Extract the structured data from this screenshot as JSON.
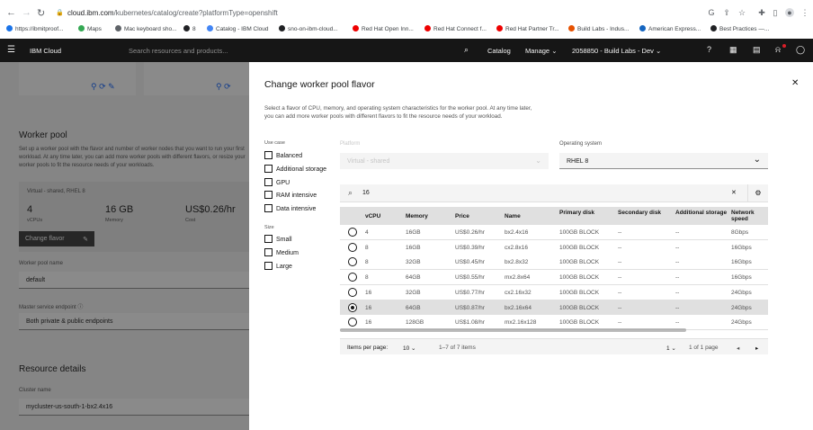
{
  "browser": {
    "url_host": "cloud.ibm.com",
    "url_path": "/kubernetes/catalog/create?platformType=openshift",
    "bookmarks": [
      {
        "label": "https://ibmitproof...",
        "color": "#1a73e8"
      },
      {
        "label": "Maps",
        "color": "#34a853"
      },
      {
        "label": "Mac keyboard sho...",
        "color": "#5f6368"
      },
      {
        "label": "8",
        "color": "#202124"
      },
      {
        "label": "Catalog - IBM Cloud",
        "color": "#4285f4"
      },
      {
        "label": "sno-on-ibm-cloud...",
        "color": "#202124"
      },
      {
        "label": "Red Hat Open Inn...",
        "color": "#ee0000"
      },
      {
        "label": "Red Hat Connect f...",
        "color": "#ee0000"
      },
      {
        "label": "Red Hat Partner Tr...",
        "color": "#ee0000"
      },
      {
        "label": "Build Labs - Indus...",
        "color": "#e65100"
      },
      {
        "label": "American Express...",
        "color": "#1565c0"
      },
      {
        "label": "Best Practices —...",
        "color": "#202124"
      }
    ]
  },
  "header": {
    "brand": "IBM Cloud",
    "search_placeholder": "Search resources and products...",
    "catalog": "Catalog",
    "manage": "Manage",
    "account": "2058850 - Build Labs - Dev"
  },
  "background": {
    "worker_pool_title": "Worker pool",
    "worker_pool_desc": "Set up a worker pool with the flavor and number of worker nodes that you want to run your first workload. At any time later, you can add more worker pools with different flavors, or resize your worker pools to fit the resource needs of your workloads.",
    "flavor_summary": "Virtual - shared, RHEL 8",
    "vcpu_value": "4",
    "vcpu_label": "vCPUs",
    "memory_value": "16 GB",
    "memory_label": "Memory",
    "cost_value": "US$0.26/hr",
    "cost_label": "Cost",
    "change_flavor": "Change flavor",
    "pool_name_label": "Worker pool name",
    "pool_name_value": "default",
    "endpoint_label": "Master service endpoint",
    "endpoint_value": "Both private & public endpoints",
    "resource_title": "Resource details",
    "cluster_name_label": "Cluster name",
    "cluster_name_value": "mycluster-us-south-1-bx2.4x16"
  },
  "modal": {
    "title": "Change worker pool flavor",
    "description": "Select a flavor of CPU, memory, and operating system characteristics for the worker pool. At any time later, you can add more worker pools with different flavors to fit the resource needs of your workload.",
    "use_case_label": "Use case",
    "use_cases": [
      "Balanced",
      "Additional storage",
      "GPU",
      "RAM intensive",
      "Data intensive"
    ],
    "size_label": "Size",
    "sizes": [
      "Small",
      "Medium",
      "Large"
    ],
    "platform_label": "Platform",
    "platform_value": "Virtual - shared",
    "os_label": "Operating system",
    "os_value": "RHEL 8",
    "search_value": "16",
    "columns": [
      "vCPU",
      "Memory",
      "Price",
      "Name",
      "Primary disk",
      "Secondary disk",
      "Additional storage",
      "Network speed"
    ],
    "rows": [
      {
        "vcpu": "4",
        "memory": "16GB",
        "price": "US$0.26/hr",
        "name": "bx2.4x16",
        "primary": "100GB BLOCK",
        "secondary": "--",
        "additional": "--",
        "network": "8Gbps",
        "selected": false
      },
      {
        "vcpu": "8",
        "memory": "16GB",
        "price": "US$0.39/hr",
        "name": "cx2.8x16",
        "primary": "100GB BLOCK",
        "secondary": "--",
        "additional": "--",
        "network": "16Gbps",
        "selected": false
      },
      {
        "vcpu": "8",
        "memory": "32GB",
        "price": "US$0.45/hr",
        "name": "bx2.8x32",
        "primary": "100GB BLOCK",
        "secondary": "--",
        "additional": "--",
        "network": "16Gbps",
        "selected": false
      },
      {
        "vcpu": "8",
        "memory": "64GB",
        "price": "US$0.55/hr",
        "name": "mx2.8x64",
        "primary": "100GB BLOCK",
        "secondary": "--",
        "additional": "--",
        "network": "16Gbps",
        "selected": false
      },
      {
        "vcpu": "16",
        "memory": "32GB",
        "price": "US$0.77/hr",
        "name": "cx2.16x32",
        "primary": "100GB BLOCK",
        "secondary": "--",
        "additional": "--",
        "network": "24Gbps",
        "selected": false
      },
      {
        "vcpu": "16",
        "memory": "64GB",
        "price": "US$0.87/hr",
        "name": "bx2.16x64",
        "primary": "100GB BLOCK",
        "secondary": "--",
        "additional": "--",
        "network": "24Gbps",
        "selected": true
      },
      {
        "vcpu": "16",
        "memory": "128GB",
        "price": "US$1.08/hr",
        "name": "mx2.16x128",
        "primary": "100GB BLOCK",
        "secondary": "--",
        "additional": "--",
        "network": "24Gbps",
        "selected": false
      }
    ],
    "pagination": {
      "items_per_page_label": "Items per page:",
      "items_per_page": "10",
      "range": "1–7 of 7 items",
      "page": "1",
      "of_pages": "1 of 1 page"
    }
  }
}
